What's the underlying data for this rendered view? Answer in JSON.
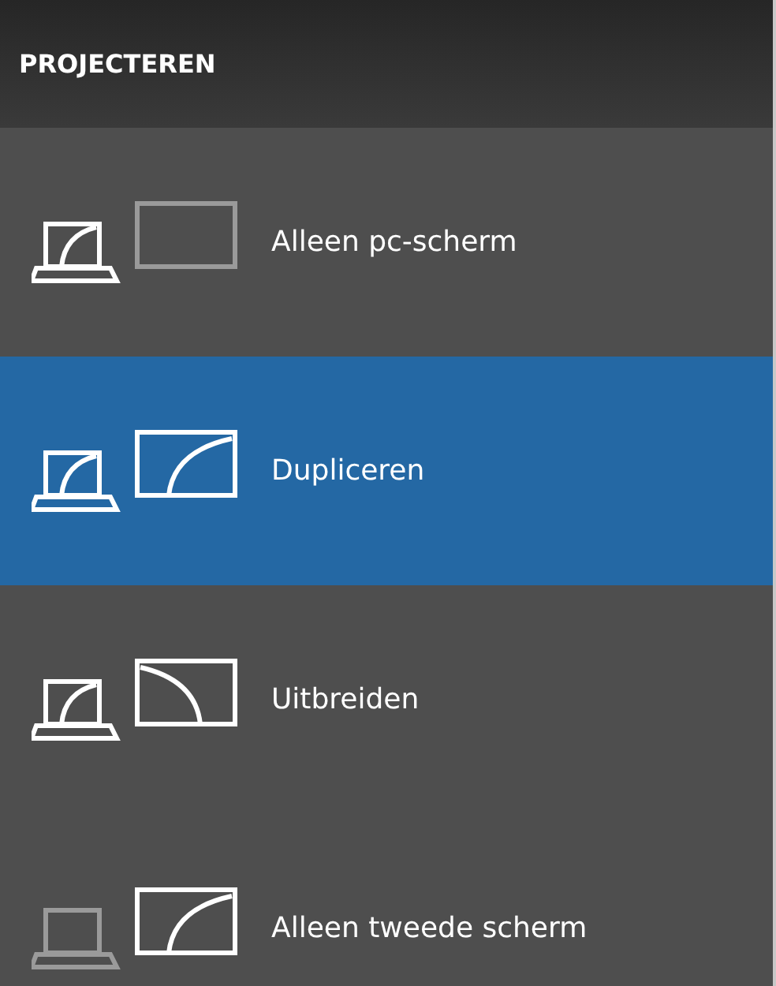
{
  "title": "PROJECTEREN",
  "options": [
    {
      "kind": "pc_only",
      "label": "Alleen pc-scherm",
      "selected": false
    },
    {
      "kind": "duplicate",
      "label": "Dupliceren",
      "selected": true
    },
    {
      "kind": "extend",
      "label": "Uitbreiden",
      "selected": false
    },
    {
      "kind": "second_only",
      "label": "Alleen tweede scherm",
      "selected": false
    }
  ]
}
